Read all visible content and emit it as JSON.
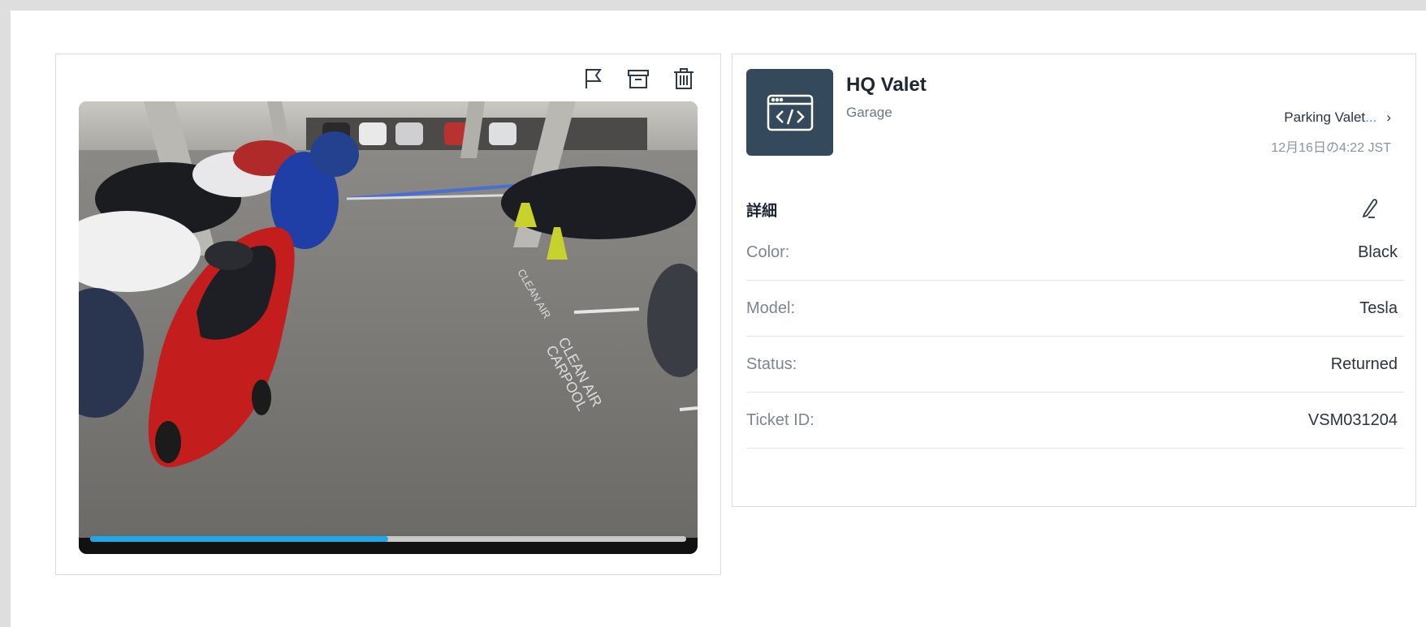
{
  "toolbar": {
    "flag_icon": "flag-icon",
    "archive_icon": "archive-icon",
    "trash_icon": "trash-icon"
  },
  "video": {
    "progress_fraction": 0.5,
    "colors": {
      "progress": "#1ea8ea",
      "track": "#c9c9c9"
    }
  },
  "header": {
    "title": "HQ Valet",
    "subtitle": "Garage",
    "app_icon": "code-window-icon",
    "tile_color": "#34495c"
  },
  "breadcrumb": {
    "label": "Parking Valet",
    "ellipsis": "...",
    "chevron": "›"
  },
  "timestamp": "12月16日の4:22 JST",
  "details": {
    "section_title": "詳細",
    "rows": [
      {
        "label": "Color:",
        "value": "Black"
      },
      {
        "label": "Model:",
        "value": "Tesla"
      },
      {
        "label": "Status:",
        "value": "Returned"
      },
      {
        "label": "Ticket ID:",
        "value": "VSM031204"
      }
    ]
  }
}
